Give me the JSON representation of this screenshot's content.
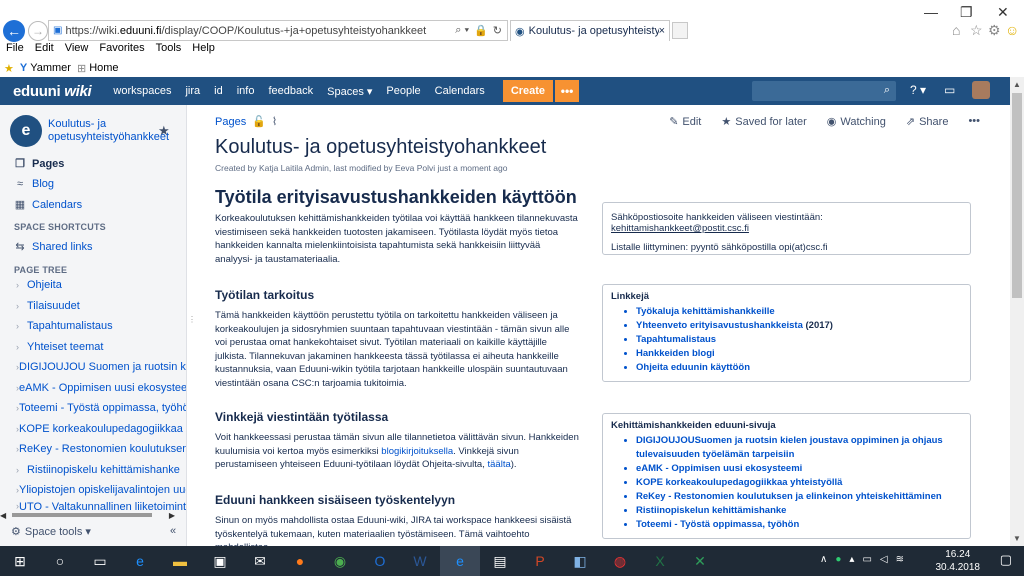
{
  "browser": {
    "url_prefix": "https://wiki.",
    "url_domain": "eduuni.fi",
    "url_rest": "/display/COOP/Koulutus-+ja+opetusyhteistyohankkeet",
    "tab_title": "Koulutus- ja opetusyhteistyo...",
    "menu": [
      "File",
      "Edit",
      "View",
      "Favorites",
      "Tools",
      "Help"
    ],
    "favorites": [
      "Yammer",
      "Home"
    ]
  },
  "header": {
    "logo_main": "eduuni",
    "logo_sub": "wiki",
    "nav": [
      "workspaces",
      "jira",
      "id",
      "info",
      "feedback",
      "Spaces ▾",
      "People",
      "Calendars"
    ],
    "create_label": "Create",
    "more_label": "•••",
    "help_label": "? ▾"
  },
  "sidebar": {
    "space_initial": "e",
    "space_name": "Koulutus- ja opetusyhteistyöhankkeet",
    "nav": [
      {
        "label": "Pages",
        "icon": "pages-icon"
      },
      {
        "label": "Blog",
        "icon": "blog-icon"
      },
      {
        "label": "Calendars",
        "icon": "calendar-icon"
      }
    ],
    "shortcuts_heading": "SPACE SHORTCUTS",
    "shortcuts": [
      "Shared links"
    ],
    "tree_heading": "PAGE TREE",
    "tree": [
      "Ohjeita",
      "Tilaisuudet",
      "Tapahtumalistaus",
      "Yhteiset teemat",
      "DIGIJOUJOU Suomen ja ruotsin kiel",
      "eAMK - Oppimisen uusi ekosysteem",
      "Toteemi - Työstä oppimassa, työhön",
      "KOPE korkeakoulupedagogiikkaa yh",
      "ReKey - Restonomien koulutuksen ja",
      "Ristiinopiskelu kehittämishanke",
      "Yliopistojen opiskelijavalintojen uudi",
      "UTO - Valtakunnallinen liiketoimintal"
    ],
    "space_tools": "Space tools ▾"
  },
  "page": {
    "breadcrumb": "Pages",
    "actions": {
      "edit": "Edit",
      "saved": "Saved for later",
      "watching": "Watching",
      "share": "Share",
      "more": "•••"
    },
    "title": "Koulutus- ja opetusyhteistyohankkeet",
    "meta": "Created by Katja Laitila Admin, last modified by Eeva Polvi just a moment ago",
    "heading": "Työtila erityisavustushankkeiden käyttöön",
    "intro": "Korkeakoulutuksen kehittämishankkeiden työtilaa voi käyttää hankkeen tilannekuvasta viestimiseen sekä hankkeiden tuotosten jakamiseen. Työtilasta löydät myös tietoa hankkeiden kannalta mielenkiintoisista tapahtumista sekä hankkeisiin liittyvää analyysi- ja taustamateriaalia.",
    "s1_title": "Työtilan tarkoitus",
    "s1_text": "Tämä hankkeiden käyttöön perustettu työtila on tarkoitettu hankkeiden väliseen ja korkeakoulujen ja sidosryhmien suuntaan tapahtuvaan viestintään - tämän sivun alle voi perustaa omat hankekohtaiset sivut. Työtilan materiaali on kaikille käyttäjille julkista. Tilannekuvan jakaminen hankkeesta tässä työtilassa ei aiheuta hankkeille kustannuksia, vaan Eduuni-wikin työtila tarjotaan hankkeille ulospäin suuntautuvaan viestintään osana CSC:n tarjoamia tukitoimia.",
    "s2_title": "Vinkkejä viestintään työtilassa",
    "s2_a": "Voit hankkeessasi perustaa tämän sivun alle tilannetietoa välittävän sivun. Hankkeiden kuulumisia voi kertoa myös esimerkiksi ",
    "s2_link1": "blogikirjoituksella",
    "s2_b": ". Vinkkejä sivun perustamiseen yhteiseen Eduuni-työtilaan löydät Ohjeita-sivulta, ",
    "s2_link2": "täälta",
    "s2_c": ").",
    "s3_title": "Eduuni hankkeen sisäiseen työskentelyyn",
    "s3_text": "Sinun on myös mahdollista ostaa Eduuni-wiki, JIRA tai workspace hankkeesi sisäistä työskentelyä tukemaan, kuten materiaalien työstämiseen. Tämä vaihtoehto mahdollistaa"
  },
  "panels": {
    "contact_label1": "Sähköpostiosoite hankkeiden väliseen viestintään: ",
    "contact_email": "kehittamishankkeet@postit.csc.fi",
    "contact_label2": "Listalle liittyminen: pyyntö sähköpostilla opi(at)csc.fi",
    "links_title": "Linkkejä",
    "links": [
      "Työkaluja kehittämishankkeille",
      "Yhteenveto erityisavustushankkeista",
      "Tapahtumalistaus",
      "Hankkeiden blogi",
      "Ohjeita eduunin käyttöön"
    ],
    "links_suffix": " (2017)",
    "projects_title": "Kehittämishankkeiden eduuni-sivuja",
    "projects": [
      "DIGIJOUJOU",
      "eAMK - Oppimisen uusi ekosysteemi",
      "KOPE korkeakoulupedagogiikkaa yhteistyöllä",
      "ReKey - Restonomien koulutuksen ja elinkeinon yhteiskehittäminen",
      "Ristiinopiskelun kehittämishanke",
      "Toteemi - Työstä oppimassa, työhön"
    ],
    "digijoujou_rest": "Suomen ja ruotsin kielen joustava oppiminen ja ohjaus tulevaisuuden työelämän tarpeisiin"
  },
  "taskbar": {
    "time": "16.24",
    "date": "30.4.2018"
  }
}
